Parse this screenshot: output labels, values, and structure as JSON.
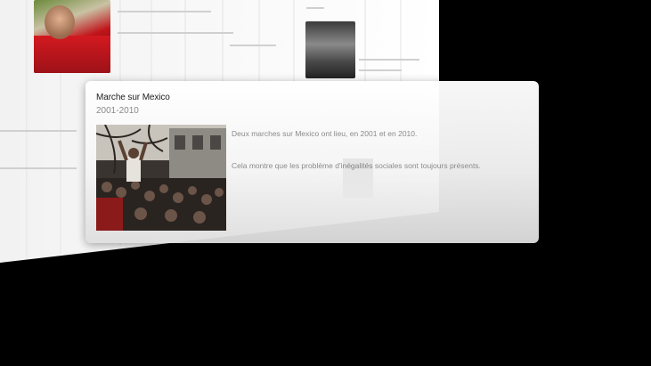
{
  "card": {
    "title": "Marche sur Mexico",
    "period": "2001-2010",
    "paragraphs": [
      "Deux marches sur Mexico ont lieu, en 2001 et en 2010.",
      "Cela montre que les problème d'inégalités sociales sont toujours présents."
    ],
    "photo_icon": "protest-crowd-photo"
  },
  "background": {
    "photo_1_icon": "portrait-photo",
    "photo_2_icon": "crowd-photo"
  },
  "colors": {
    "screen_background": "#000000",
    "panel_background": "#ffffff",
    "card_title": "#222222",
    "card_body": "#8a8a8a"
  }
}
